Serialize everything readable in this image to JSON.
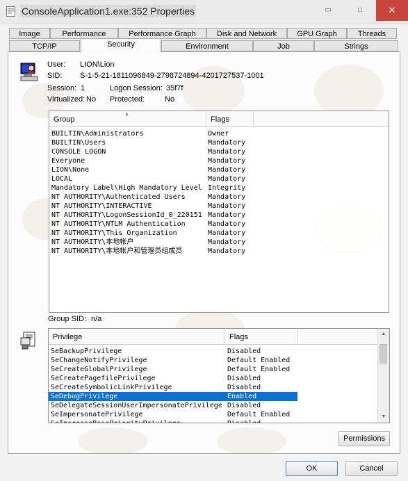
{
  "window": {
    "title": "ConsoleApplication1.exe:352 Properties",
    "min_glyph": "▭",
    "max_glyph": "□",
    "close_glyph": "✕"
  },
  "tabs_back": [
    "Image",
    "Performance",
    "Performance Graph",
    "Disk and Network",
    "GPU Graph",
    "Threads"
  ],
  "tabs_front": [
    "TCP/IP",
    "Security",
    "Environment",
    "Job",
    "Strings"
  ],
  "active_tab": "Security",
  "user_info": {
    "user_label": "User:",
    "user_value": "LION\\Lion",
    "sid_label": "SID:",
    "sid_value": "S-1-5-21-1811096849-2798724894-4201727537-1001",
    "session_label": "Session:",
    "session_value": "1",
    "logon_label": "Logon Session:",
    "logon_value": "35f7f",
    "virtualized_label": "Virtualized:",
    "virtualized_value": "No",
    "protected_label": "Protected:",
    "protected_value": "No"
  },
  "groups": {
    "headers": [
      "Group",
      "Flags"
    ],
    "sort_glyph": "▲",
    "rows": [
      [
        "BUILTIN\\Administrators",
        "Owner"
      ],
      [
        "BUILTIN\\Users",
        "Mandatory"
      ],
      [
        "CONSOLE LOGON",
        "Mandatory"
      ],
      [
        "Everyone",
        "Mandatory"
      ],
      [
        "LION\\None",
        "Mandatory"
      ],
      [
        "LOCAL",
        "Mandatory"
      ],
      [
        "Mandatory Label\\High Mandatory Level",
        "Integrity"
      ],
      [
        "NT AUTHORITY\\Authenticated Users",
        "Mandatory"
      ],
      [
        "NT AUTHORITY\\INTERACTIVE",
        "Mandatory"
      ],
      [
        "NT AUTHORITY\\LogonSessionId_0_220151",
        "Mandatory"
      ],
      [
        "NT AUTHORITY\\NTLM Authentication",
        "Mandatory"
      ],
      [
        "NT AUTHORITY\\This Organization",
        "Mandatory"
      ],
      [
        "NT AUTHORITY\\本地帐户",
        "Mandatory"
      ],
      [
        "NT AUTHORITY\\本地帐户和管理员组成员",
        "Mandatory"
      ]
    ]
  },
  "group_sid": {
    "label": "Group SID:",
    "value": "n/a"
  },
  "privileges": {
    "headers": [
      "Privilege",
      "Flags"
    ],
    "selected_index": 5,
    "rows": [
      [
        "SeBackupPrivilege",
        "Disabled"
      ],
      [
        "SeChangeNotifyPrivilege",
        "Default Enabled"
      ],
      [
        "SeCreateGlobalPrivilege",
        "Default Enabled"
      ],
      [
        "SeCreatePagefilePrivilege",
        "Disabled"
      ],
      [
        "SeCreateSymbolicLinkPrivilege",
        "Disabled"
      ],
      [
        "SeDebugPrivilege",
        "Enabled"
      ],
      [
        "SeDelegateSessionUserImpersonatePrivilege",
        "Disabled"
      ],
      [
        "SeImpersonatePrivilege",
        "Default Enabled"
      ],
      [
        "SeIncreaseBasePriorityPrivilege",
        "Disabled"
      ]
    ]
  },
  "buttons": {
    "permissions": "Permissions",
    "ok": "OK",
    "cancel": "Cancel"
  },
  "colors": {
    "selection": "#0a72d6",
    "close_button": "#c8463b"
  }
}
